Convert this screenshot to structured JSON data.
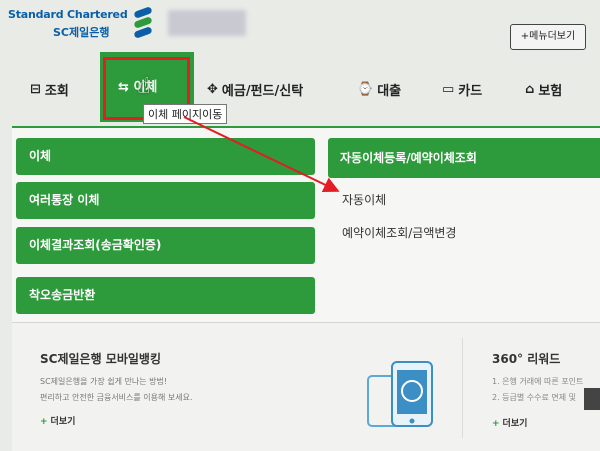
{
  "header": {
    "logo_line1": "Standard Chartered",
    "logo_line2": "SC제일은행",
    "menu_more": "+메뉴더보기"
  },
  "nav": {
    "items": [
      {
        "icon": "⊟",
        "label": "조회"
      },
      {
        "icon": "⇆",
        "label": "이체"
      },
      {
        "icon": "✥",
        "label": "예금/펀드/신탁"
      },
      {
        "icon": "⌚",
        "label": "대출"
      },
      {
        "icon": "▭",
        "label": "카드"
      },
      {
        "icon": "⌂",
        "label": "보험"
      }
    ],
    "tooltip": "이체 페이지이동"
  },
  "dropdown": {
    "left_menu": [
      "이체",
      "여러통장 이체",
      "이체결과조회(송금확인증)",
      "착오송금반환"
    ],
    "sub_heading": "자동이체등록/예약이체조회",
    "sub_items": [
      "자동이체",
      "예약이체조회/금액변경"
    ]
  },
  "mobile": {
    "title": "SC제일은행 모바일뱅킹",
    "desc1": "SC제일은행을 가장 쉽게 만나는 방법!",
    "desc2": "편리하고 안전한 금융서비스를 이용해 보세요.",
    "more": "더보기"
  },
  "reward": {
    "title": "360° 리워드",
    "desc1": "1. 은행 거래에 따른 포인트",
    "desc2": "2. 등급별 수수료 면제  및",
    "more": "더보기"
  },
  "colors": {
    "brand_green": "#2d9a3c",
    "brand_blue": "#0a5fa8",
    "highlight_red": "#e21d23"
  }
}
